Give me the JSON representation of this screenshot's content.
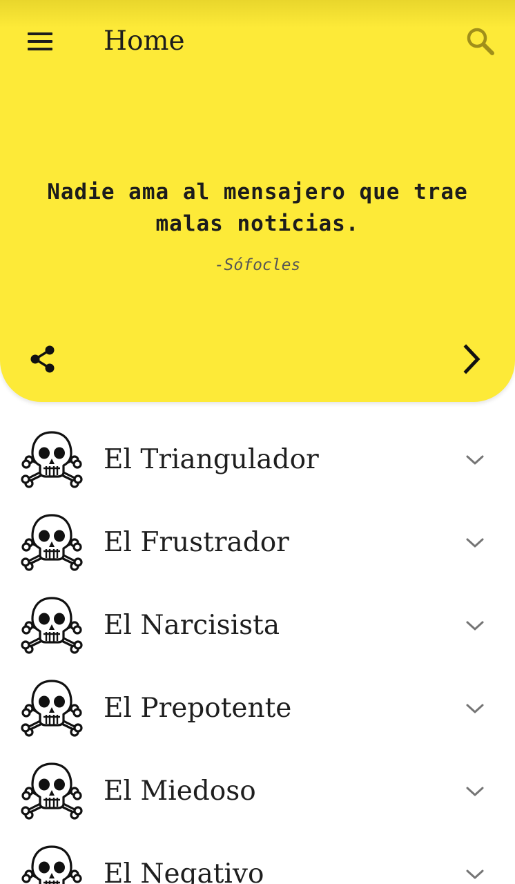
{
  "appbar": {
    "title": "Home",
    "menu_icon": "hamburger-menu-icon",
    "search_icon": "search-icon"
  },
  "quote": {
    "text": "Nadie ama al mensajero que trae malas noticias.",
    "author": "-Sófocles",
    "share_icon": "share-icon",
    "next_icon": "chevron-right-icon"
  },
  "colors": {
    "header_background": "#fdea38",
    "text": "#1c1c1c",
    "author_text": "#555555",
    "chevron": "#757575"
  },
  "list": {
    "item_icon": "skull-crossbones-icon",
    "expand_icon": "chevron-down-icon",
    "items": [
      {
        "label": "El Triangulador"
      },
      {
        "label": "El Frustrador"
      },
      {
        "label": "El Narcisista"
      },
      {
        "label": "El Prepotente"
      },
      {
        "label": "El Miedoso"
      },
      {
        "label": "El Negativo"
      }
    ]
  }
}
